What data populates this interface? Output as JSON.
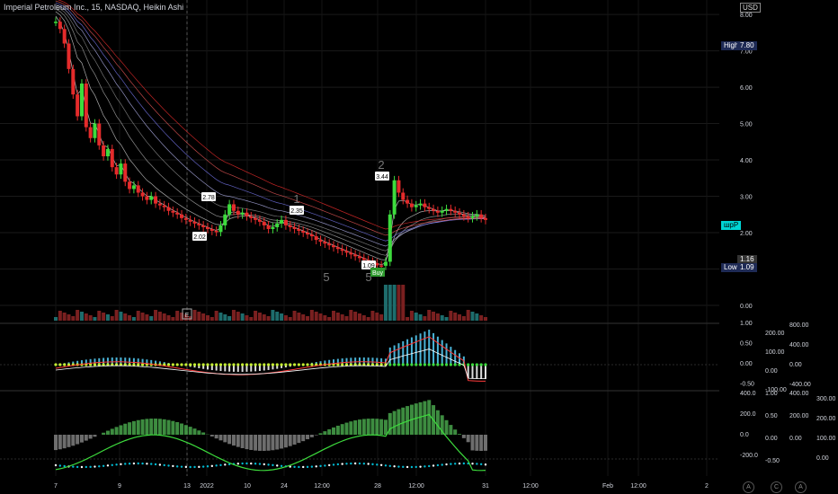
{
  "header": {
    "title": "Imperial Petroleum Inc., 15, NASDAQ, Heikin Ashi",
    "currency": "USD"
  },
  "price_axis": {
    "ticks": [
      "8.00",
      "7.00",
      "6.00",
      "5.00",
      "4.00",
      "3.00",
      "2.00",
      "1.00",
      "0.00"
    ]
  },
  "tags": {
    "high_label": "High",
    "high_value": "7.80",
    "low_label": "Low",
    "low_value": "1.09",
    "price_116": "1.16",
    "last_label": "шрР"
  },
  "x_axis": {
    "ticks": [
      "7",
      "9",
      "13",
      "2022",
      "10",
      "24",
      "12:00",
      "28",
      "12:00",
      "31",
      "12:00",
      "Feb",
      "12:00",
      "2"
    ]
  },
  "annotations": {
    "buy_label": "Buy",
    "e_marker": "E",
    "labels": [
      "2.78",
      "2.02",
      "2.35",
      "3.44",
      "1.09",
      "2",
      "1",
      "5",
      "5"
    ]
  },
  "macd_axis": {
    "left_ticks": [
      "1.00",
      "0.50",
      "0.00",
      "-0.50"
    ],
    "mid_ticks": [
      "200.00",
      "100.00",
      "0.00",
      "-100.00"
    ],
    "right_ticks": [
      "800.00",
      "400.00",
      "0.00",
      "-400.00"
    ]
  },
  "osc_axis": {
    "col1": [
      "400.0",
      "200.0",
      "0.0",
      "-200.0"
    ],
    "col2": [
      "1.00",
      "0.50",
      "0.00",
      "-0.50"
    ],
    "col3": [
      "400.00",
      "200.00",
      "0.00"
    ],
    "col4": [
      "300.00",
      "200.00",
      "100.00",
      "0.00"
    ]
  },
  "corner_icons": [
    "A",
    "C",
    "A"
  ],
  "chart_data": {
    "type": "candlestick",
    "title": "Imperial Petroleum Inc., 15, NASDAQ, Heikin Ashi",
    "ylim": [
      0,
      8.2
    ],
    "high": 7.8,
    "low": 1.09,
    "close": [
      7.8,
      7.6,
      7.2,
      6.5,
      5.8,
      5.2,
      6.1,
      4.9,
      4.6,
      5.0,
      4.4,
      4.1,
      4.3,
      3.8,
      3.6,
      3.9,
      3.4,
      3.2,
      3.3,
      3.1,
      3.0,
      2.9,
      3.0,
      2.8,
      2.75,
      2.7,
      2.6,
      2.55,
      2.5,
      2.4,
      2.35,
      2.3,
      2.25,
      2.2,
      2.15,
      2.1,
      2.05,
      2.02,
      2.2,
      2.5,
      2.78,
      2.6,
      2.5,
      2.55,
      2.45,
      2.4,
      2.35,
      2.3,
      2.2,
      2.1,
      2.15,
      2.25,
      2.35,
      2.2,
      2.15,
      2.1,
      2.05,
      2.0,
      1.95,
      1.9,
      1.8,
      1.75,
      1.7,
      1.65,
      1.6,
      1.55,
      1.5,
      1.45,
      1.4,
      1.35,
      1.3,
      1.25,
      1.2,
      1.16,
      1.1,
      1.09,
      1.2,
      2.5,
      3.44,
      3.1,
      2.9,
      2.8,
      2.7,
      2.75,
      2.8,
      2.7,
      2.65,
      2.6,
      2.55,
      2.6,
      2.65,
      2.6,
      2.55,
      2.5,
      2.45,
      2.4,
      2.45,
      2.5,
      2.4,
      2.35
    ]
  }
}
